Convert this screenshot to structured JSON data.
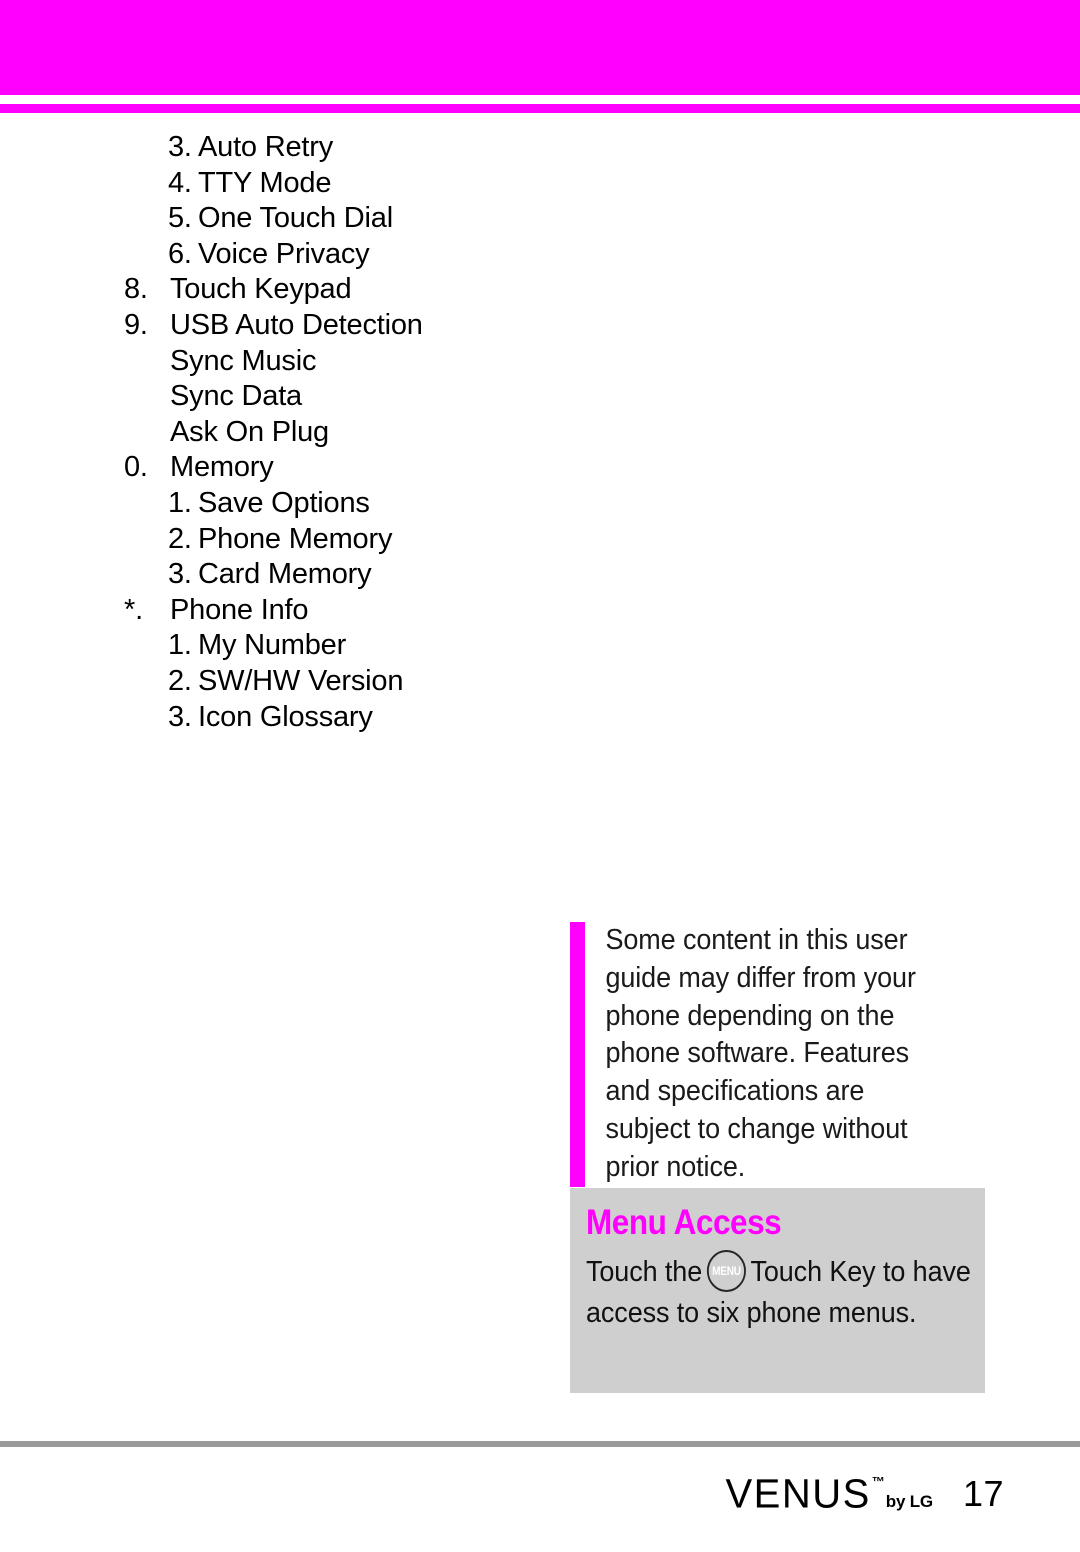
{
  "page": {
    "number": "17",
    "accent_color": "#ff00ff",
    "panel_color": "#cfcfcf",
    "rule_color": "#9a9a9a"
  },
  "menu_outline": {
    "rows": [
      {
        "level": 2,
        "marker": "3.",
        "label": "Auto Retry"
      },
      {
        "level": 2,
        "marker": "4.",
        "label": "TTY Mode"
      },
      {
        "level": 2,
        "marker": "5.",
        "label": "One Touch Dial"
      },
      {
        "level": 2,
        "marker": "6.",
        "label": "Voice Privacy"
      },
      {
        "level": 1,
        "marker": "8.",
        "label": "Touch Keypad"
      },
      {
        "level": 1,
        "marker": "9.",
        "label": "USB Auto Detection"
      },
      {
        "level": 21,
        "marker": "",
        "label": "Sync Music"
      },
      {
        "level": 21,
        "marker": "",
        "label": "Sync Data"
      },
      {
        "level": 21,
        "marker": "",
        "label": "Ask On Plug"
      },
      {
        "level": 1,
        "marker": "0.",
        "label": "Memory"
      },
      {
        "level": 2,
        "marker": "1.",
        "label": "Save Options"
      },
      {
        "level": 2,
        "marker": "2.",
        "label": "Phone Memory"
      },
      {
        "level": 2,
        "marker": "3.",
        "label": "Card Memory"
      },
      {
        "level": 1,
        "marker": "*.",
        "label": "Phone Info"
      },
      {
        "level": 2,
        "marker": "1.",
        "label": "My Number"
      },
      {
        "level": 2,
        "marker": "2.",
        "label": "SW/HW Version"
      },
      {
        "level": 2,
        "marker": "3.",
        "label": "Icon Glossary"
      }
    ]
  },
  "note": {
    "text": "Some content in this user guide may differ from your phone depending on the phone software. Features and specifications are subject to change without prior notice."
  },
  "menu_access": {
    "title": "Menu Access",
    "body_before_icon": "Touch the",
    "icon_label": "MENU",
    "body_after_icon": "Touch Key to have access to six phone menus."
  },
  "footer": {
    "brand": "VENUS",
    "trademark": "™",
    "by_line": "by LG",
    "page_number": "17"
  }
}
